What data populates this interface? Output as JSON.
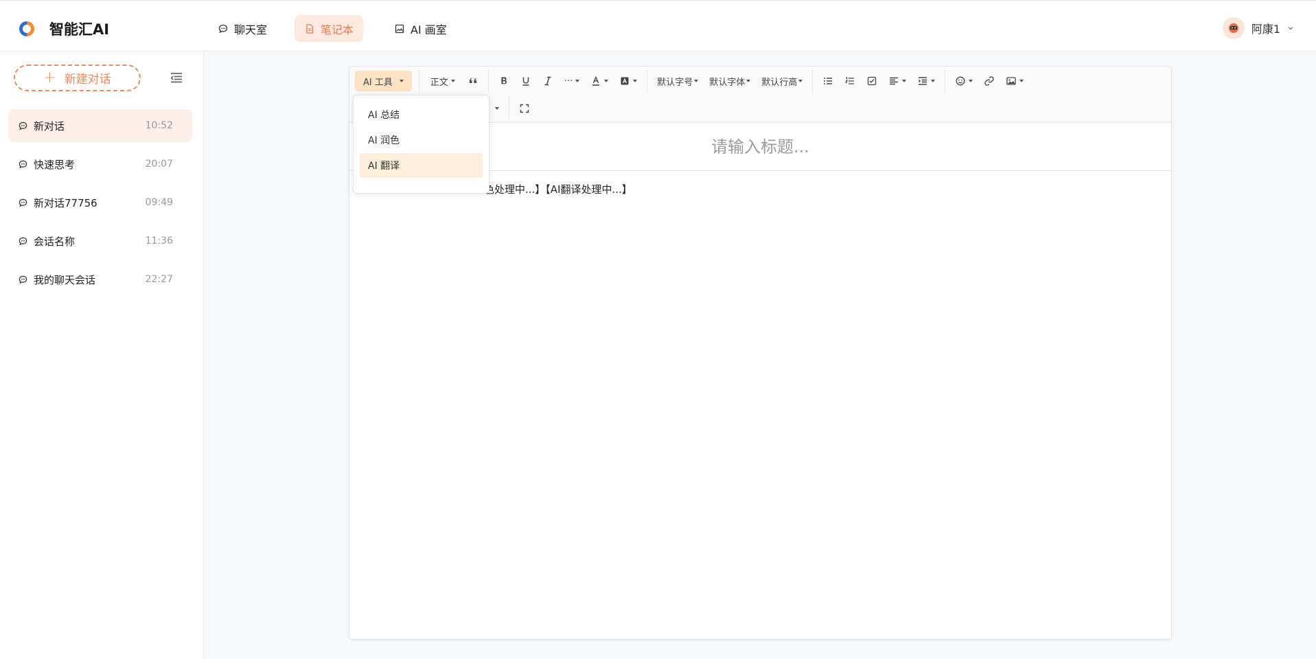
{
  "app": {
    "title": "智能汇AI"
  },
  "nav": {
    "tabs": [
      {
        "label": "聊天室",
        "icon": "chat-bubble-icon",
        "active": false
      },
      {
        "label": "笔记本",
        "icon": "document-icon",
        "active": true
      },
      {
        "label": "AI 画室",
        "icon": "image-icon",
        "active": false
      }
    ]
  },
  "user": {
    "name": "阿康1"
  },
  "sidebar": {
    "new_chat_label": "新建对话",
    "chats": [
      {
        "name": "新对话",
        "time": "10:52",
        "active": true
      },
      {
        "name": "快速思考",
        "time": "20:07",
        "active": false
      },
      {
        "name": "新对话77756",
        "time": "09:49",
        "active": false
      },
      {
        "name": "会话名称",
        "time": "11:36",
        "active": false
      },
      {
        "name": "我的聊天会话",
        "time": "22:27",
        "active": false
      }
    ]
  },
  "toolbar": {
    "ai_tool_label": "AI 工具",
    "paragraph_label": "正文",
    "font_size_label": "默认字号",
    "font_family_label": "默认字体",
    "line_height_label": "默认行高",
    "more_label": "···"
  },
  "dropdown": {
    "items": [
      {
        "label": "AI 总结",
        "active": false
      },
      {
        "label": "AI 润色",
        "active": false
      },
      {
        "label": "AI 翻译",
        "active": true
      }
    ]
  },
  "editor": {
    "title_placeholder": "请输入标题...",
    "body_text": "色处理中...】【AI翻译处理中...】"
  },
  "colors": {
    "accent": "#ec7b4e",
    "accent_bg": "#fde9df",
    "ai_tool_bg": "#fde2c6"
  }
}
